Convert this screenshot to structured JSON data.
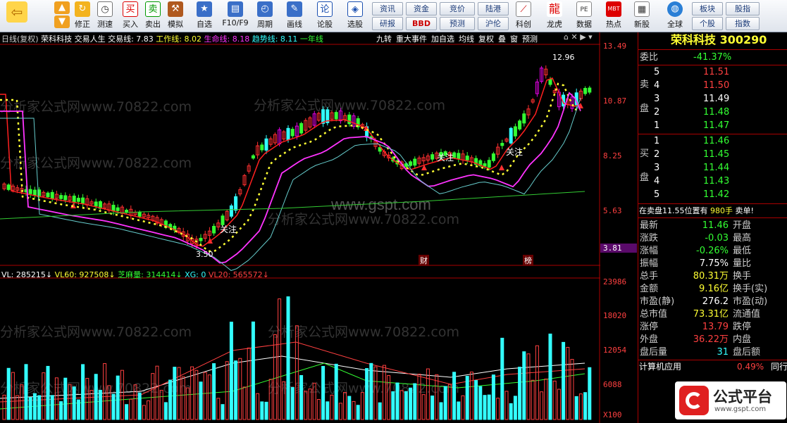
{
  "toolbar": {
    "back_label": "",
    "modify_label": "修正",
    "test_label": "测速",
    "buy_label": "买入",
    "sell_label": "卖出",
    "sim_label": "模拟",
    "watch_label": "自选",
    "f10_label": "F10/F9",
    "period_label": "周期",
    "draw_label": "画线",
    "lunguo_label": "论股",
    "pick_label": "选股",
    "news": "资讯",
    "funds": "资金",
    "auction": "竞价",
    "lugang": "陆港",
    "research": "研报",
    "bbd": "BBD",
    "forecast": "预测",
    "hugu": "沪伦",
    "keli_label": "科创",
    "longhu_label": "龙虎",
    "data_label": "数据",
    "hot_label": "热点",
    "ipo_label": "新股",
    "global_label": "全球",
    "plate": "板块",
    "stock": "个股",
    "quote": "股指",
    "index": "指数",
    "pe_icon": "PE",
    "mbt_icon": "MBT"
  },
  "chart_header": {
    "period": "日线(复权)",
    "name": "荣科科技",
    "indicator": "交易人生",
    "trade_line": "交易线: 7.83",
    "work_line": "工作线: 8.02",
    "life_line": "生命线: 8.18",
    "trend_line": "趋势线: 8.11",
    "year_line": "一年线"
  },
  "chart_tabs": [
    "九转",
    "重大事件",
    "加自选",
    "均线",
    "复权",
    "叠",
    "窗",
    "预测"
  ],
  "price_axis": [
    "13.49",
    "10.87",
    "8.25",
    "5.63",
    "3.81"
  ],
  "vol_axis": [
    "23986",
    "18020",
    "12054",
    "6088",
    "X100"
  ],
  "markers": {
    "high": "12.96",
    "low": "3.50",
    "guanzhu": "关注",
    "fin": "财",
    "bang": "榜"
  },
  "vol_header": {
    "vl": "VL: 285215↓",
    "vl60": "VL60: 927508↓",
    "zhima": "芝麻量: 314414↓",
    "xg": "XG: 0",
    "vl20": "VL20: 565572↓"
  },
  "watermark": {
    "main": "www.gspt.com",
    "side": "分析家公式网www.70822.com"
  },
  "logo": {
    "text": "公式平台",
    "url": "www.gspt.com"
  },
  "quote": {
    "title": "荣科科技",
    "code": "300290",
    "weibi_label": "委比",
    "weibi": "-41.37%",
    "sell_label": "卖",
    "buy_label": "买",
    "pan_label": "盘",
    "sell": [
      {
        "n": "5",
        "p": "11.51"
      },
      {
        "n": "4",
        "p": "11.50"
      },
      {
        "n": "3",
        "p": "11.49"
      },
      {
        "n": "2",
        "p": "11.48"
      },
      {
        "n": "1",
        "p": "11.47"
      }
    ],
    "buy": [
      {
        "n": "1",
        "p": "11.46"
      },
      {
        "n": "2",
        "p": "11.45"
      },
      {
        "n": "3",
        "p": "11.44"
      },
      {
        "n": "4",
        "p": "11.43"
      },
      {
        "n": "5",
        "p": "11.42"
      }
    ],
    "notice": "在卖盘11.55位置有",
    "notice_vol": "980手",
    "notice_tail": "卖单!",
    "stats": [
      {
        "l1": "最新",
        "v1": "11.46",
        "c1": "g",
        "l2": "开盘"
      },
      {
        "l1": "涨跌",
        "v1": "-0.03",
        "c1": "g",
        "l2": "最高"
      },
      {
        "l1": "涨幅",
        "v1": "-0.26%",
        "c1": "g",
        "l2": "最低"
      },
      {
        "l1": "振幅",
        "v1": "7.75%",
        "c1": "w",
        "l2": "量比"
      },
      {
        "l1": "总手",
        "v1": "80.31万",
        "c1": "y",
        "l2": "换手"
      },
      {
        "l1": "金额",
        "v1": "9.16亿",
        "c1": "y",
        "l2": "换手(实)"
      },
      {
        "l1": "市盈(静)",
        "v1": "276.2",
        "c1": "w",
        "l2": "市盈(动)"
      },
      {
        "l1": "总市值",
        "v1": "73.31亿",
        "c1": "y",
        "l2": "流通值"
      },
      {
        "l1": "涨停",
        "v1": "13.79",
        "c1": "r",
        "l2": "跌停"
      },
      {
        "l1": "外盘",
        "v1": "36.22万",
        "c1": "r",
        "l2": "内盘"
      },
      {
        "l1": "盘后量",
        "v1": "31",
        "c1": "c",
        "l2": "盘后额"
      }
    ],
    "sector": "计算机应用",
    "sector_pct": "0.49%",
    "sector_tail": "同行"
  },
  "colors": {
    "up": "#ff4040",
    "down": "#33ffff",
    "panel_border": "#aa0000"
  }
}
